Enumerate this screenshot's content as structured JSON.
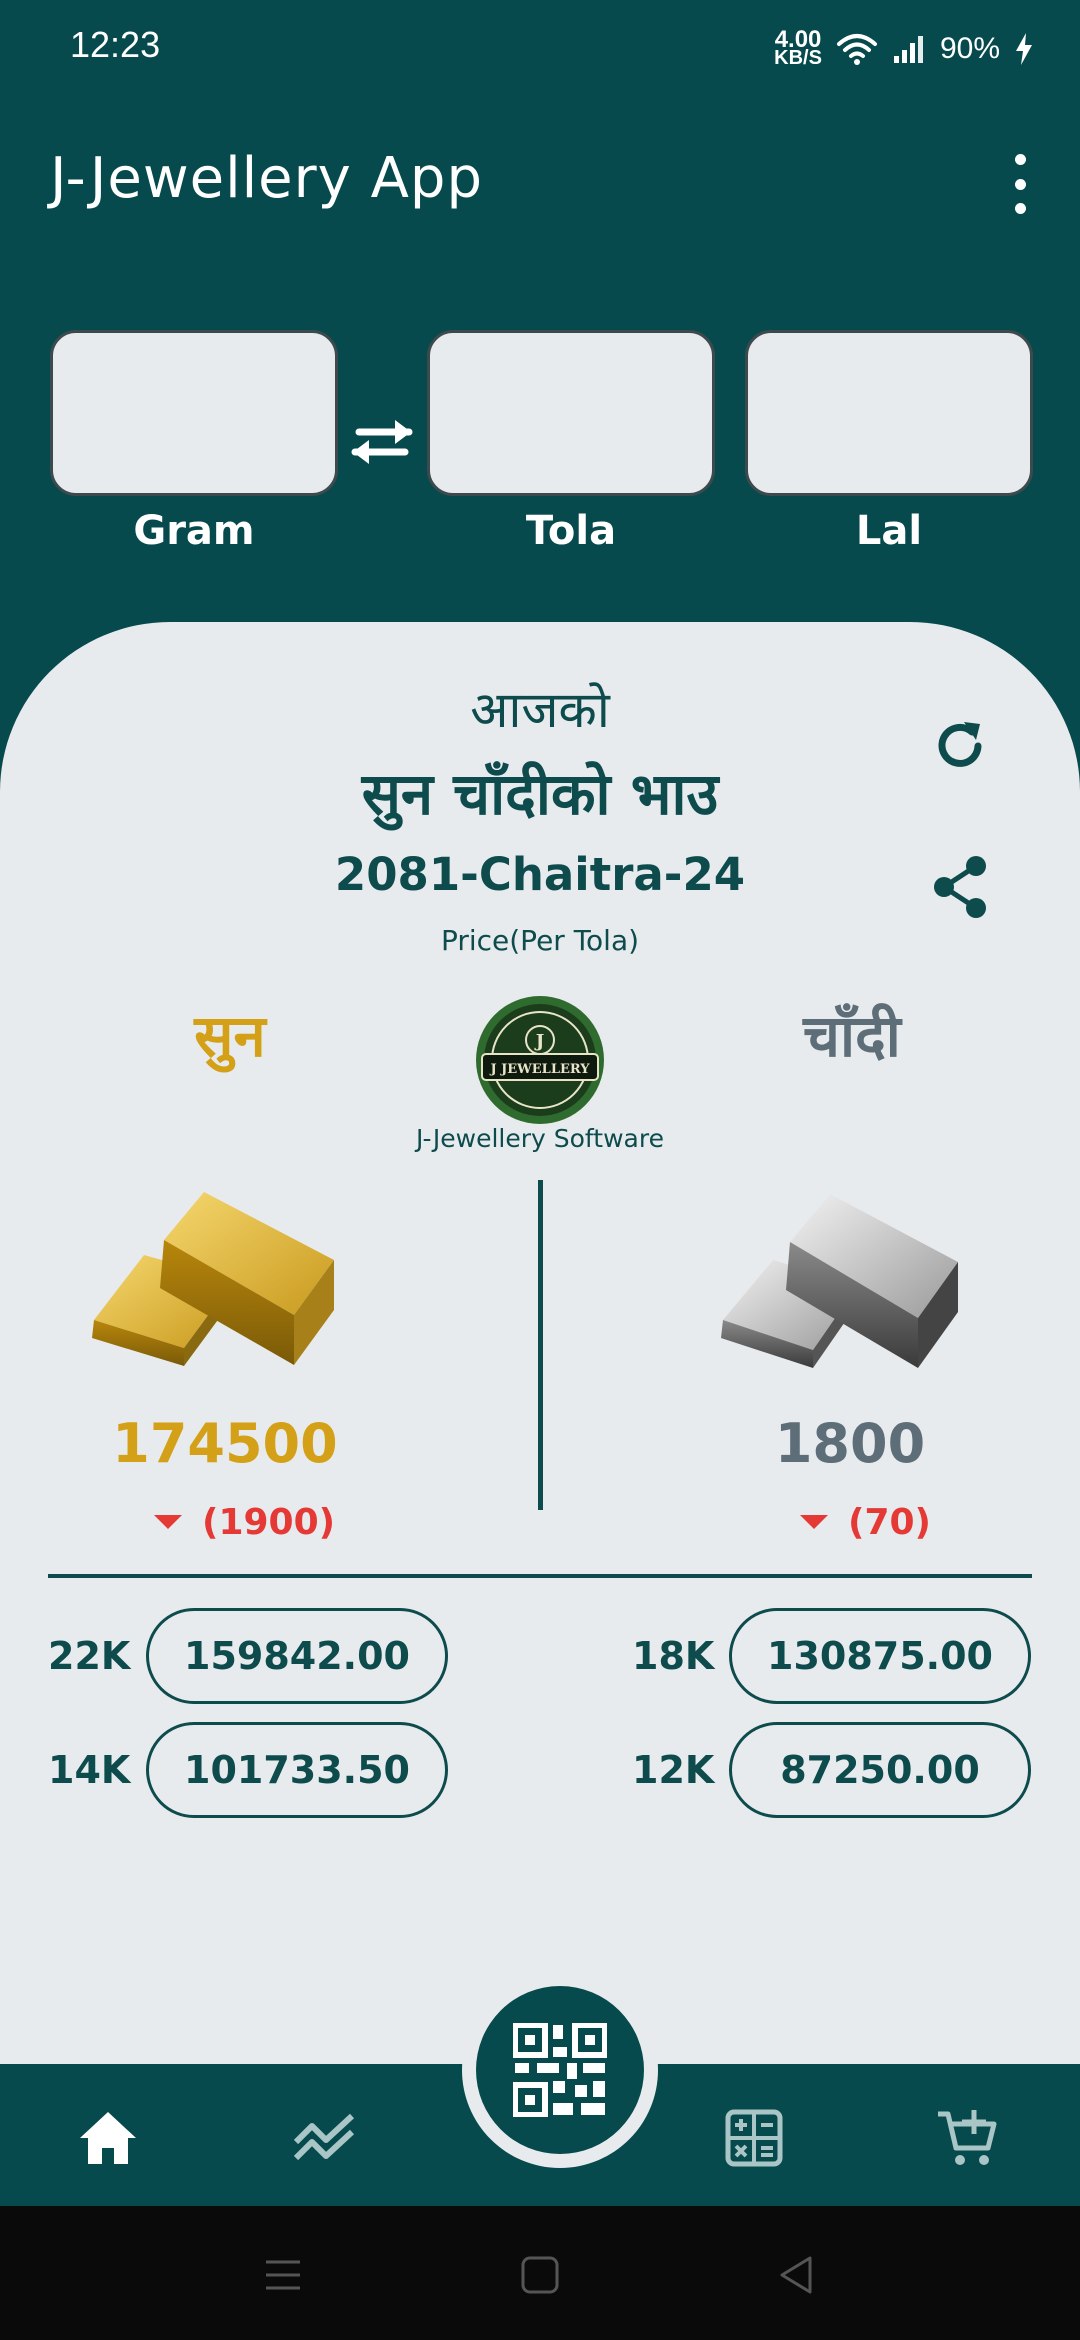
{
  "status_bar": {
    "time": "12:23",
    "net_speed_value": "4.00",
    "net_speed_unit": "KB/S",
    "battery": "90%"
  },
  "app_bar": {
    "title": "J-Jewellery App",
    "menu_icon": "more-vertical-icon"
  },
  "converter": {
    "gram_label": "Gram",
    "tola_label": "Tola",
    "lal_label": "Lal",
    "gram_value": "",
    "tola_value": "",
    "lal_value": "",
    "swap_icon": "swap-arrows-icon"
  },
  "rates": {
    "today": "आजको",
    "title": "सुन चाँदीको भाउ",
    "date": "2081-Chaitra-24",
    "price_unit": "Price(Per Tola)",
    "logo_caption": "J-Jewellery Software",
    "logo_text": "J JEWELLERY",
    "gold": {
      "label": "सुन",
      "price": "174500",
      "change": "(1900)",
      "color": "#d4a017"
    },
    "silver": {
      "label": "चाँदी",
      "price": "1800",
      "change": "(70)",
      "color": "#5e6e78"
    },
    "change_color": "#e53935"
  },
  "karats": [
    {
      "label": "22K",
      "value": "159842.00"
    },
    {
      "label": "18K",
      "value": "130875.00"
    },
    {
      "label": "14K",
      "value": "101733.50"
    },
    {
      "label": "12K",
      "value": "87250.00"
    }
  ],
  "bottom_nav": {
    "items": [
      "home-icon",
      "chart-icon",
      "qr-code-icon",
      "calculator-icon",
      "add-cart-icon"
    ]
  },
  "theme": {
    "primary": "#074a4d",
    "surface": "#e8ebee"
  }
}
